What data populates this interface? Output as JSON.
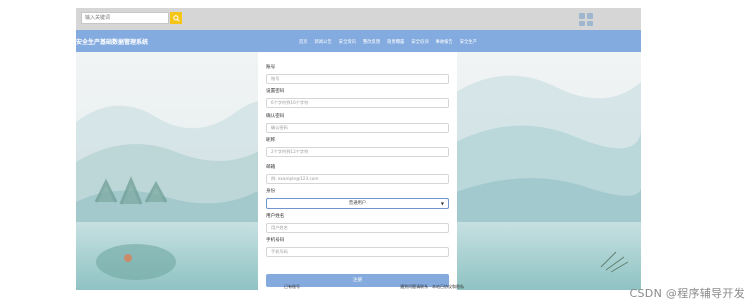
{
  "search": {
    "placeholder": "输入关键词"
  },
  "header": {
    "title": "安全生产基础数据管理系统",
    "nav": [
      "首页",
      "新闻公告",
      "安全资讯",
      "整改反馈",
      "隐患曝露",
      "安全培训",
      "事故报告",
      "安全生产"
    ]
  },
  "form": {
    "fields": [
      {
        "label": "账号",
        "placeholder": "账号"
      },
      {
        "label": "设置密码",
        "placeholder": "6个字符到16个字符"
      },
      {
        "label": "确认密码",
        "placeholder": "确认密码"
      },
      {
        "label": "昵称",
        "placeholder": "2个字符到12个字符"
      },
      {
        "label": "邮箱",
        "placeholder": "例: example@123.com"
      }
    ],
    "role": {
      "label": "身份",
      "selected": "普通用户"
    },
    "fields2": [
      {
        "label": "用户姓名",
        "placeholder": "用户姓名"
      },
      {
        "label": "手机号码",
        "placeholder": "手机号码"
      }
    ],
    "submit": "注册",
    "links": {
      "left": "已有账号",
      "right": "遇到问题请联系 · 本站已协议和隐私"
    }
  },
  "watermark": "CSDN @程序辅导开发",
  "colors": {
    "navbar": "#84abe0",
    "button": "#85abde",
    "search_button": "#f5c518"
  }
}
